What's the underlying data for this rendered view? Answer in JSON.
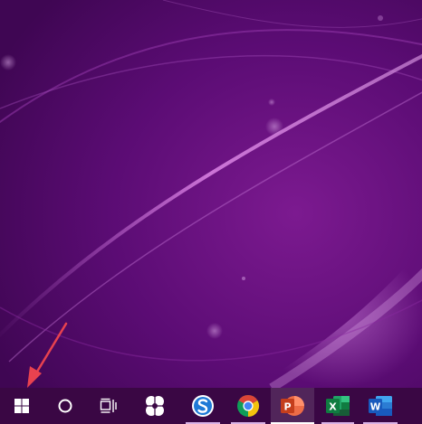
{
  "wallpaper": {
    "colors": {
      "base": "#4b0862",
      "mid": "#7c1a90",
      "glow": "#c46ad2",
      "highlight": "#b070c4"
    }
  },
  "annotation": {
    "arrow_color": "#e8424f",
    "target": "start-button"
  },
  "taskbar": {
    "background": "#3a0744",
    "items": [
      {
        "id": "start",
        "icon": "windows-logo-icon",
        "running": false
      },
      {
        "id": "search",
        "icon": "cortana-circle-icon",
        "running": false
      },
      {
        "id": "task-view",
        "icon": "task-view-icon",
        "running": false
      },
      {
        "id": "app-flower",
        "icon": "flower-app-icon",
        "running": false
      },
      {
        "id": "sogou",
        "icon": "sogou-browser-icon",
        "running": true
      },
      {
        "id": "chrome",
        "icon": "chrome-icon",
        "running": true
      },
      {
        "id": "powerpoint",
        "icon": "powerpoint-icon",
        "running": true,
        "active": true
      },
      {
        "id": "excel",
        "icon": "excel-icon",
        "running": true
      },
      {
        "id": "word",
        "icon": "word-icon",
        "running": true
      }
    ],
    "icon_colors": {
      "sogou": "#1e7ad6",
      "chrome_red": "#db4437",
      "chrome_yellow": "#f4c20d",
      "chrome_green": "#0f9d58",
      "chrome_blue": "#4285f4",
      "powerpoint": "#d24726",
      "excel": "#1d7044",
      "word": "#2b5797"
    }
  }
}
